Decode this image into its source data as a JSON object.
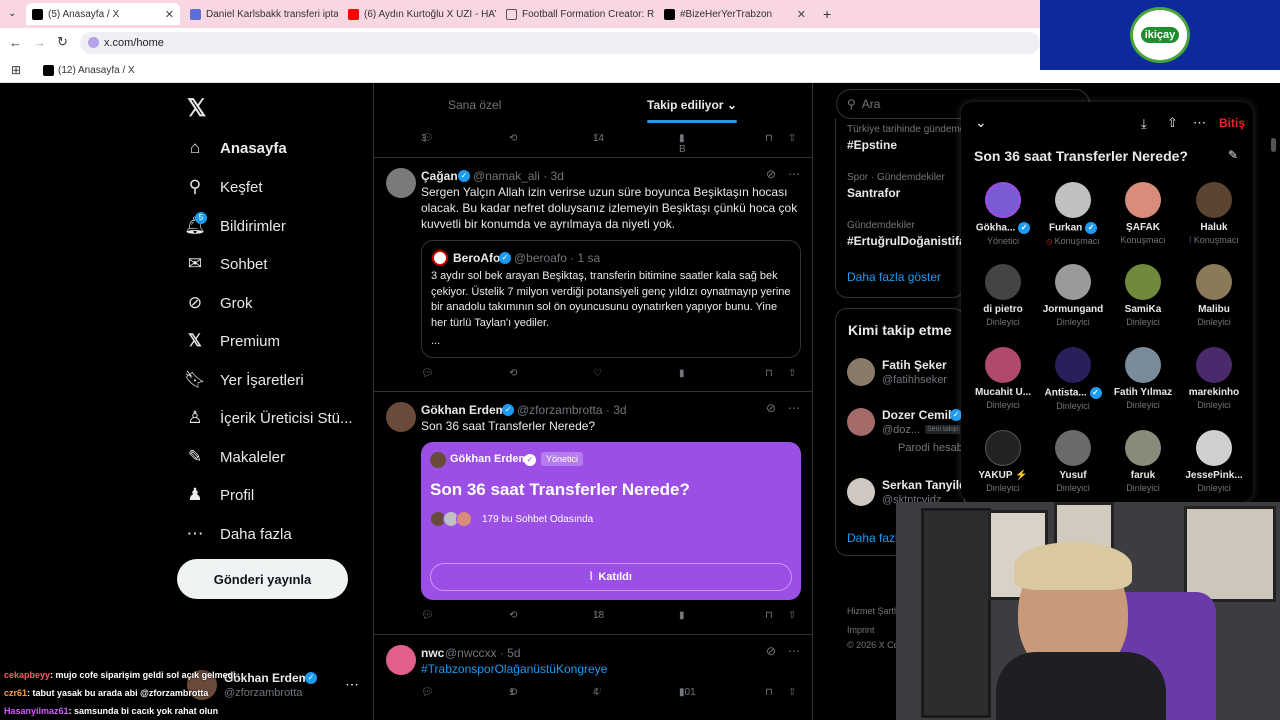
{
  "browser": {
    "tabs": [
      {
        "label": "(5) Anasayfa / X",
        "active": true
      },
      {
        "label": "Daniel Karlsbakk transferi iptal o"
      },
      {
        "label": "(6) Aydın Kurtoğlu X UZI - HAYI"
      },
      {
        "label": "Football Formation Creator: Re"
      },
      {
        "label": "#BizeHerYerTrabzon"
      }
    ],
    "new_tab": "+",
    "url": "x.com/home",
    "bookmark": "(12) Anasayfa / X"
  },
  "sponsor": {
    "text": "ikiçay"
  },
  "nav": {
    "items": [
      {
        "label": "Anasayfa",
        "icon": "home-icon"
      },
      {
        "label": "Keşfet",
        "icon": "search-icon"
      },
      {
        "label": "Bildirimler",
        "icon": "bell-icon",
        "badge": "5"
      },
      {
        "label": "Sohbet",
        "icon": "mail-icon"
      },
      {
        "label": "Grok",
        "icon": "grok-icon"
      },
      {
        "label": "Premium",
        "icon": "x-icon"
      },
      {
        "label": "Yer İşaretleri",
        "icon": "bookmark-icon"
      },
      {
        "label": "İçerik Üreticisi Stü...",
        "icon": "creator-icon"
      },
      {
        "label": "Makaleler",
        "icon": "article-icon"
      },
      {
        "label": "Profil",
        "icon": "person-icon"
      },
      {
        "label": "Daha fazla",
        "icon": "more-icon"
      }
    ],
    "post_button": "Gönderi yayınla"
  },
  "feed": {
    "tabs": {
      "for_you": "Sana özel",
      "following": "Takip ediliyor"
    },
    "top_actions": {
      "reply": "3",
      "like": "14",
      "views": "1 B"
    },
    "tweets": [
      {
        "name": "Çağan",
        "handle": "@namak_ali · 3d",
        "text": "Sergen Yalçın Allah izin verirse uzun süre boyunca Beşiktaşın hocası olacak. Bu kadar nefret doluysanız izlemeyin Beşiktaşı çünkü hoca çok kuvvetli bir konumda ve ayrılmaya da niyeti yok.",
        "quote": {
          "name": "BeroAfo",
          "handle": "@beroafo · 1 sa",
          "text": "3 aydır sol bek arayan Beşiktaş, transferin bitimine saatler kala sağ bek çekiyor. Üstelik 7 milyon verdiği potansiyeli genç yıldızı oynatmayıp yerine bir anadolu takımının sol ön oyuncusunu oynatırken yapıyor bunu. Yine her türlü Taylan'ı yediler.",
          "more": "..."
        }
      },
      {
        "name": "Gökhan Erdem",
        "handle": "@zforzambrotta · 3d",
        "text": "Son 36 saat Transferler Nerede?",
        "space": {
          "host": "Gökhan Erdem",
          "host_role": "Yönetici",
          "title": "Son 36 saat Transferler Nerede?",
          "listeners": "179 bu Sohbet Odasında",
          "button": "Katıldı"
        },
        "actions": {
          "like": "18"
        }
      },
      {
        "name": "nwc",
        "handle": "@nwccxx · 5d",
        "text": "#TrabzonsporOlağanüstüKongreye",
        "actions": {
          "retweet": "1",
          "like": "4",
          "views": "101"
        }
      }
    ]
  },
  "right": {
    "search_placeholder": "Ara",
    "trends": [
      {
        "sub": "Türkiye tarihinde gündemde",
        "main": "#Epstine"
      },
      {
        "sub": "Spor · Gündemdekiler",
        "main": "Santrafor"
      },
      {
        "sub": "Gündemdekiler",
        "main": "#ErtuğrulDoğanistifa"
      }
    ],
    "show_more": "Daha fazla göster",
    "who_to_follow": {
      "title": "Kimi takip etme",
      "users": [
        {
          "name": "Fatih Şeker",
          "handle": "@fatihhseker"
        },
        {
          "name": "Dozer Cemil",
          "handle": "@doz...",
          "tag": "Seni takip",
          "sub": "Parodi hesab"
        },
        {
          "name": "Serkan Tanyild",
          "handle": "@sktntcvidz"
        }
      ],
      "show_more": "Daha fazl"
    },
    "footer": [
      "Hizmet Şartları",
      "Imprint",
      "© 2026 X Cor"
    ]
  },
  "space_panel": {
    "title": "Son 36 saat Transferler Nerede?",
    "end_button": "Bitiş",
    "people": [
      {
        "name": "Gökha...",
        "role": "Yönetici",
        "color": "#7b5ad6"
      },
      {
        "name": "Furkan",
        "role": "Konuşmacı",
        "color": "#c0c0c0"
      },
      {
        "name": "ŞAFAK",
        "role": "Konuşmacı",
        "color": "#d98c7a"
      },
      {
        "name": "Haluk",
        "role": "Konuşmacı",
        "color": "#5b4432"
      },
      {
        "name": "di pietro",
        "role": "Dinleyici",
        "color": "#444"
      },
      {
        "name": "Jormungand",
        "role": "Dinleyici",
        "color": "#9a9a9a"
      },
      {
        "name": "SamiKa",
        "role": "Dinleyici",
        "color": "#6f8a3b"
      },
      {
        "name": "Malibu",
        "role": "Dinleyici",
        "color": "#8a7a5a"
      },
      {
        "name": "Mucahit U...",
        "role": "Dinleyici",
        "color": "#b04a6a"
      },
      {
        "name": "Antista...",
        "role": "Dinleyici",
        "color": "#2a1f5a"
      },
      {
        "name": "Fatih Yılmaz",
        "role": "Dinleyici",
        "color": "#7a8c9a"
      },
      {
        "name": "marekinho",
        "role": "Dinleyici",
        "color": "#4a2a6a"
      },
      {
        "name": "YAKUP ⚡",
        "role": "Dinleyici",
        "color": "#222"
      },
      {
        "name": "Yusuf",
        "role": "Dinleyici",
        "color": "#6a6a6a"
      },
      {
        "name": "faruk",
        "role": "Dinleyici",
        "color": "#8a8a7a"
      },
      {
        "name": "JessePink...",
        "role": "Dinleyici",
        "color": "#d0d0d0"
      }
    ]
  },
  "chat": [
    {
      "user": "cekapbeyy",
      "msg": ": mujo cofe siparişim geldi sol açık gelmedi",
      "color": "#ff5a5a"
    },
    {
      "user": "czr61",
      "msg": ": tabut yasak bu arada abi @zforzambrotta",
      "color": "#ff9a3a"
    },
    {
      "user": "Hasanyilmaz61",
      "msg": ": samsunda bi cacık yok rahat olun",
      "color": "#d25aff"
    }
  ],
  "account": {
    "name": "Gökhan Erdem",
    "handle": "@zforzambrotta"
  }
}
